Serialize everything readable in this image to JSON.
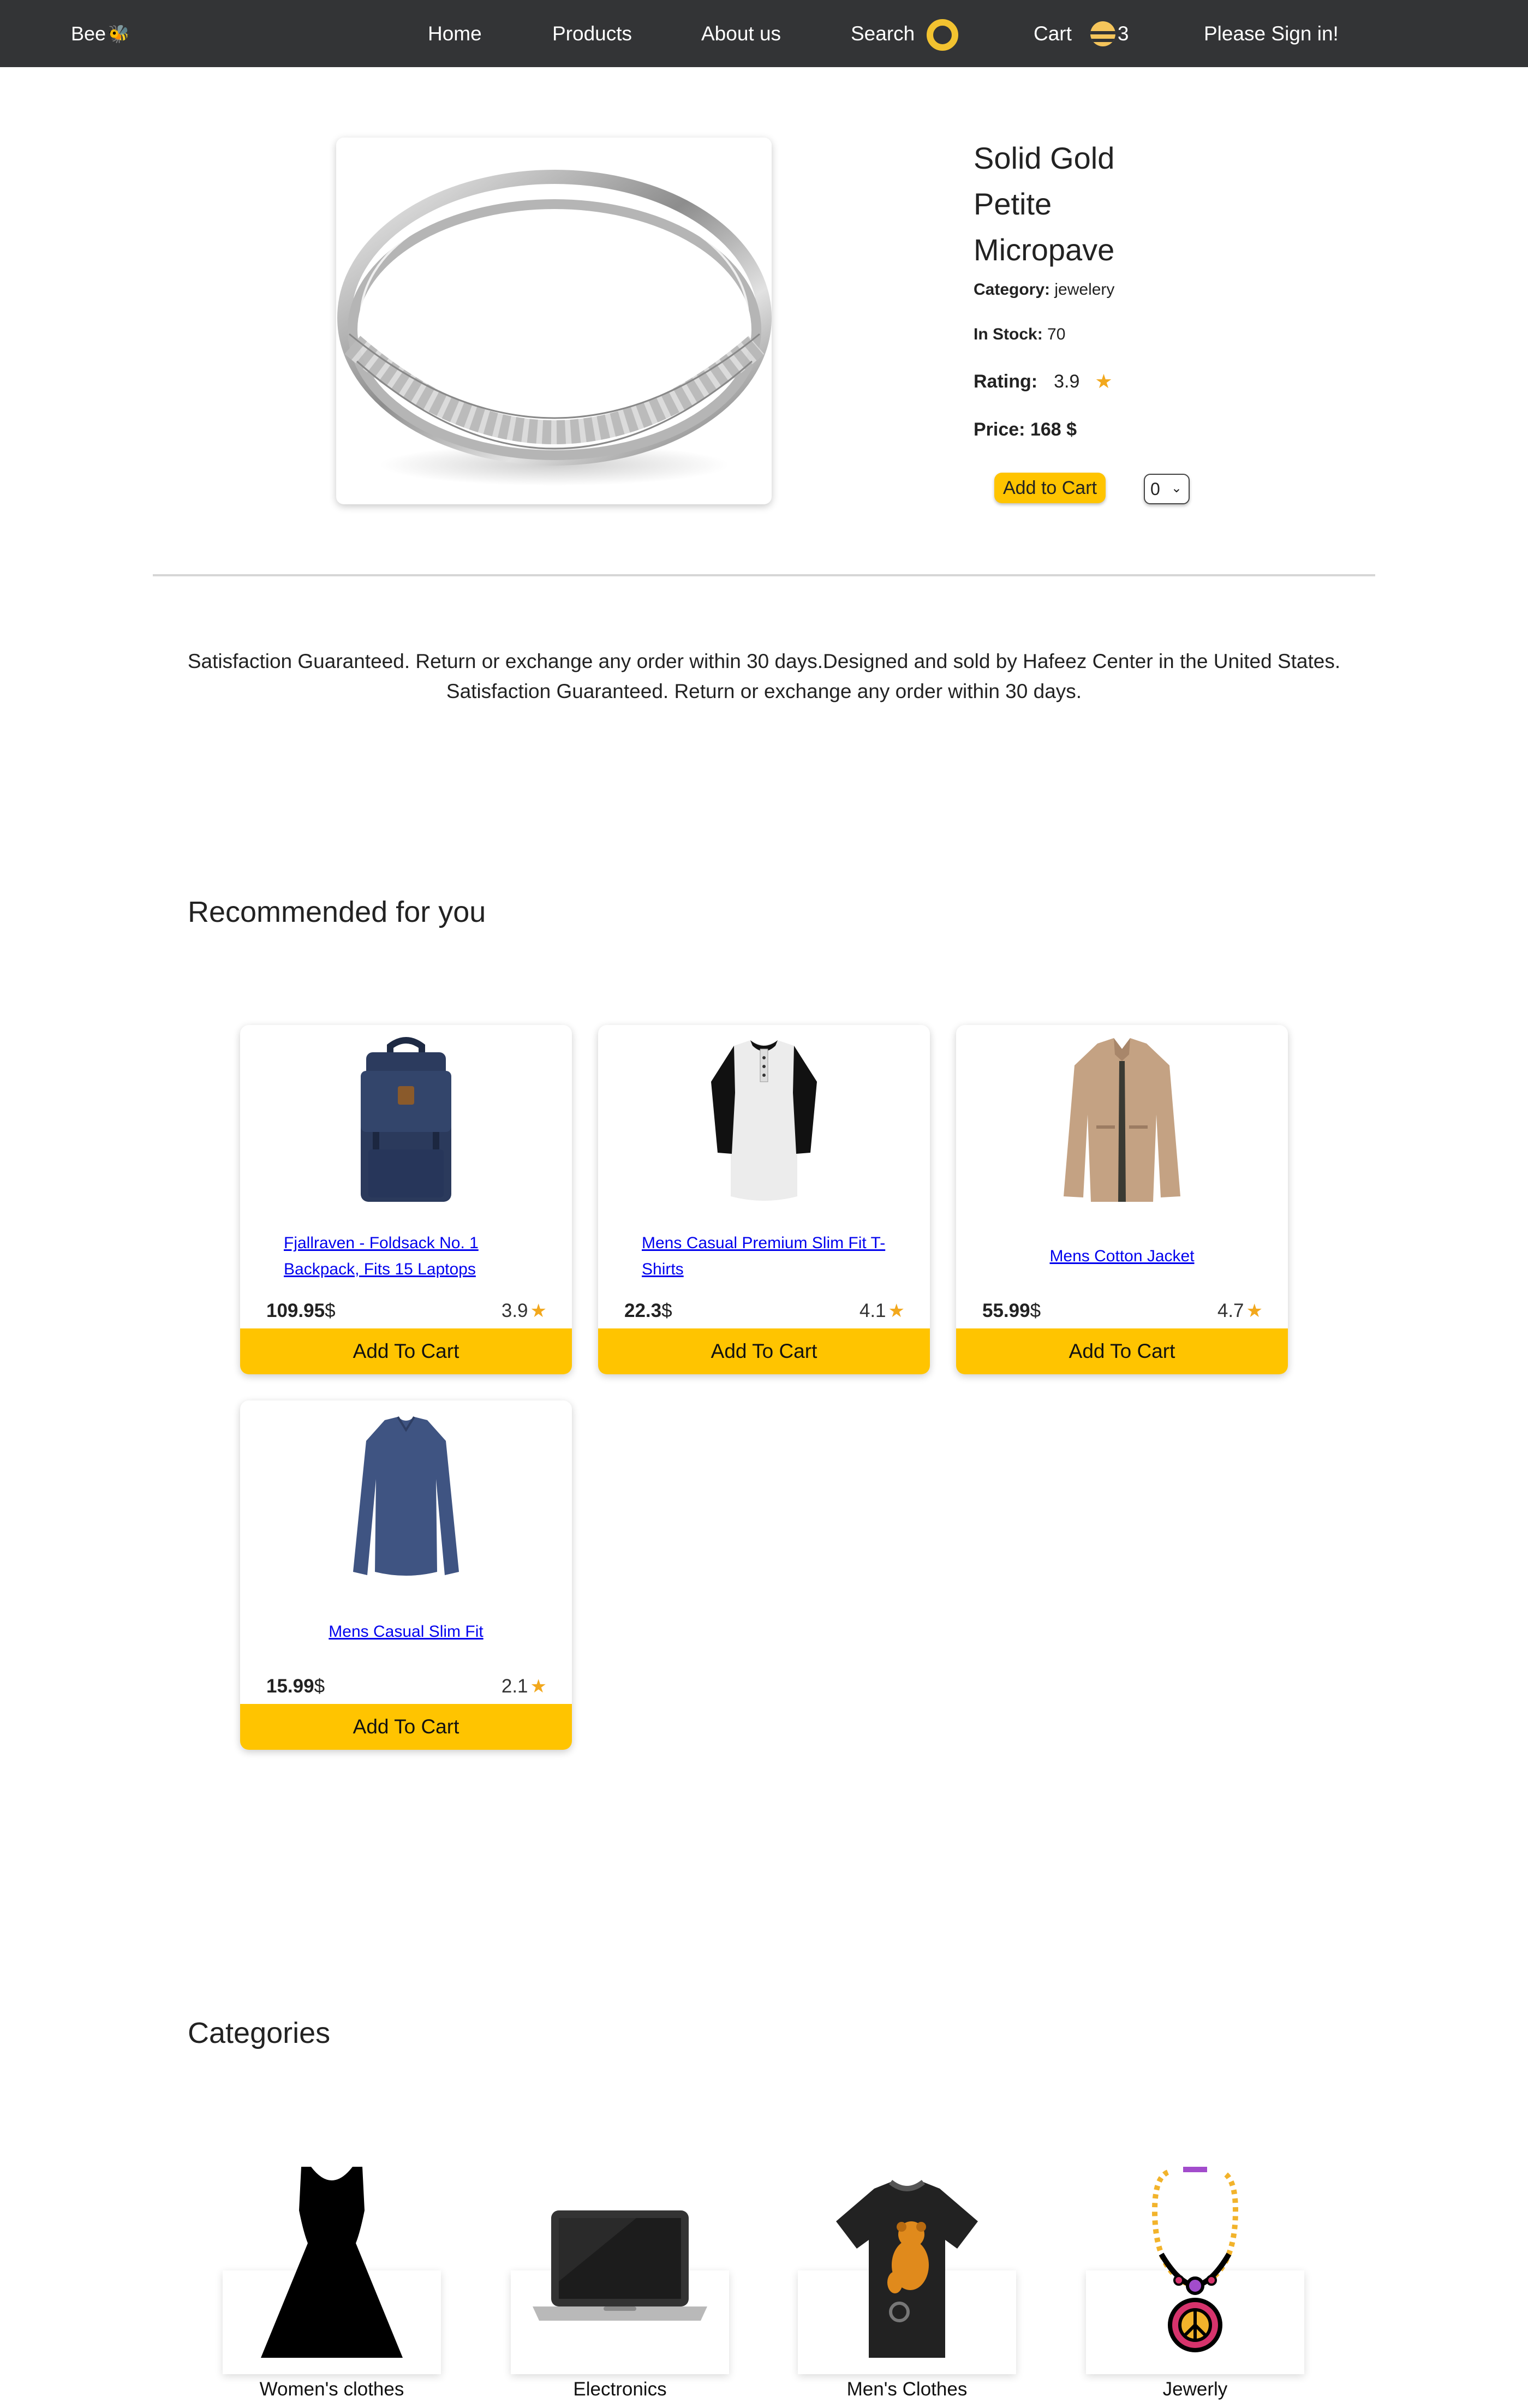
{
  "nav": {
    "brand": "Bee",
    "home": "Home",
    "products": "Products",
    "about": "About us",
    "search": "Search",
    "cart": "Cart",
    "cart_count": "3",
    "signin": "Please Sign in!"
  },
  "product": {
    "title": "Solid Gold Petite Micropave",
    "category_label": "Category:",
    "category": "jewelery",
    "stock_label": "In Stock:",
    "stock": "70",
    "rating_label": "Rating:",
    "rating": "3.9",
    "price_label": "Price:",
    "price": "168 $",
    "add_to_cart": "Add to Cart",
    "quantity": "0"
  },
  "description": {
    "line1": "Satisfaction Guaranteed. Return or exchange any order within 30 days.Designed and sold by Hafeez Center in the United States.",
    "line2": "Satisfaction Guaranteed. Return or exchange any order within 30 days."
  },
  "recommended": {
    "title": "Recommended for you",
    "items": [
      {
        "name": "Fjallraven - Foldsack No. 1 Backpack, Fits 15 Laptops",
        "price": "109.95",
        "currency": "$",
        "rating": "3.9",
        "button": "Add To Cart",
        "icon": "backpack-icon"
      },
      {
        "name": "Mens Casual Premium Slim Fit T-Shirts",
        "price": "22.3",
        "currency": "$",
        "rating": "4.1",
        "button": "Add To Cart",
        "icon": "tshirt-icon"
      },
      {
        "name": "Mens Cotton Jacket",
        "price": "55.99",
        "currency": "$",
        "rating": "4.7",
        "button": "Add To Cart",
        "icon": "jacket-icon"
      },
      {
        "name": "Mens Casual Slim Fit",
        "price": "15.99",
        "currency": "$",
        "rating": "2.1",
        "button": "Add To Cart",
        "icon": "longsleeve-icon"
      }
    ]
  },
  "categories": {
    "title": "Categories",
    "items": [
      {
        "label": "Women's clothes",
        "icon": "dress-icon"
      },
      {
        "label": "Electronics",
        "icon": "laptop-icon"
      },
      {
        "label": "Men's Clothes",
        "icon": "mens-tshirt-icon"
      },
      {
        "label": "Jewerly",
        "icon": "necklace-icon"
      }
    ]
  },
  "colors": {
    "nav_bg": "#333436",
    "accent": "#ffc400",
    "star": "#f2a81d",
    "link": "#0000ee"
  }
}
